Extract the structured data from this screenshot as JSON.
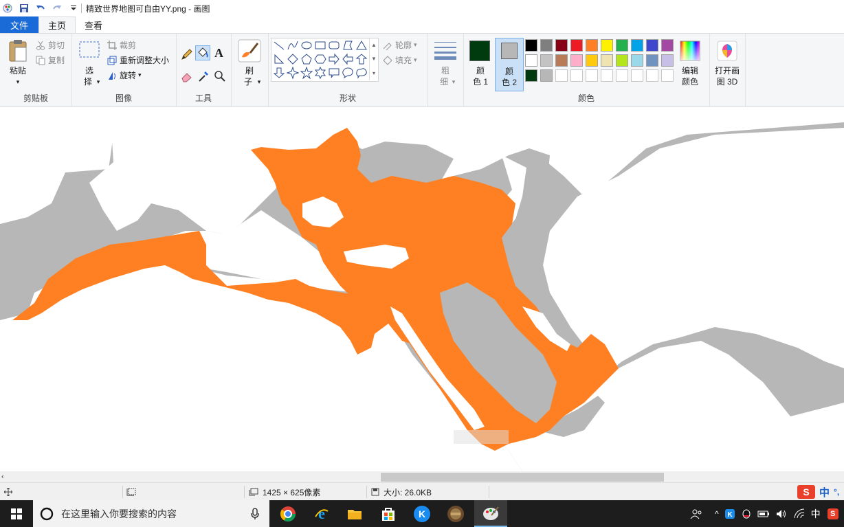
{
  "window": {
    "title": "精致世界地图可自由YY.png - 画图"
  },
  "tabs": [
    "文件",
    "主页",
    "查看"
  ],
  "ribbon": {
    "clipboard": {
      "paste": "粘贴",
      "cut": "剪切",
      "copy": "复制",
      "label": "剪贴板"
    },
    "image": {
      "select_top": "选",
      "select_bottom": "择",
      "crop": "裁剪",
      "resize": "重新调整大小",
      "rotate": "旋转",
      "label": "图像"
    },
    "tools": {
      "label": "工具"
    },
    "brush": {
      "top": "刷",
      "bottom": "子"
    },
    "shapes": {
      "outline": "轮廓",
      "fill": "填充",
      "label": "形状"
    },
    "size": {
      "top": "粗",
      "bottom": "细"
    },
    "colors": {
      "color1_top": "颜",
      "color1_bottom": "色 1",
      "color2_top": "颜",
      "color2_bottom": "色 2",
      "edit_top": "编辑",
      "edit_bottom": "颜色",
      "label": "颜色",
      "color1_value": "#003b10",
      "color2_value": "#b7b7b7",
      "palette_row1": [
        "#000000",
        "#7f7f7f",
        "#880015",
        "#ed1c24",
        "#ff7f27",
        "#fff200",
        "#22b14c",
        "#00a2e8",
        "#3f48cc",
        "#a349a4"
      ],
      "palette_row2": [
        "#ffffff",
        "#c3c3c3",
        "#b97a57",
        "#ffaec9",
        "#ffc90e",
        "#efe4b0",
        "#b5e61d",
        "#99d9ea",
        "#7092be",
        "#c8bfe7"
      ],
      "palette_row3": [
        "#003b10",
        "#b7b7b7"
      ]
    },
    "paint3d": {
      "top": "打开画",
      "bottom": "图 3D"
    }
  },
  "canvas": {
    "sea_color": "#b7b7b7",
    "land_color": "#ffffff",
    "empire_color": "#ff8022"
  },
  "status": {
    "dimensions": "1425 × 625像素",
    "size": "大小: 26.0KB"
  },
  "taskbar": {
    "search_placeholder": "在这里输入你要搜索的内容",
    "ime_a": "中",
    "ime_b": "中"
  }
}
